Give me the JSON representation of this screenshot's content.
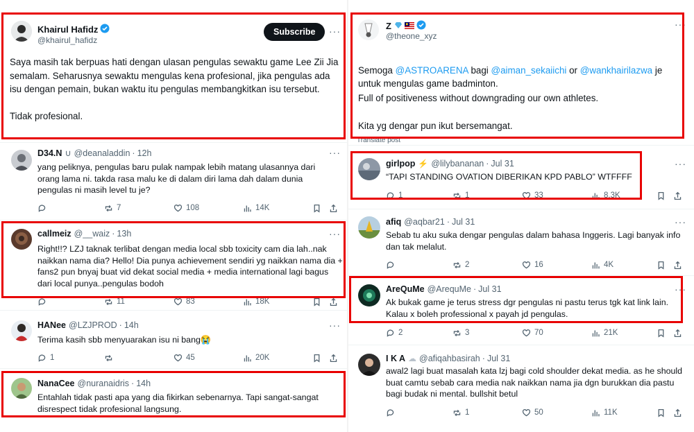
{
  "left": {
    "main": {
      "name": "Khairul Hafidz",
      "handle": "@khairul_hafidz",
      "subscribe": "Subscribe",
      "body": "Saya masih tak berpuas hati dengan ulasan pengulas sewaktu game Lee Zii Jia semalam. Seharusnya sewaktu mengulas kena profesional, jika pengulas ada isu dengan pemain, bukan waktu itu pengulas membangkitkan isu tersebut.\n\nTidak profesional."
    },
    "replies": [
      {
        "name": "D34.N",
        "badge": "∪",
        "handle": "@deanaladdin",
        "time": "12h",
        "body": "yang peliknya, pengulas baru pulak nampak lebih matang ulasannya dari orang lama ni. takda rasa malu ke di dalam diri lama dah dalam dunia pengulas ni masih level tu je?",
        "replies": "",
        "reposts": "7",
        "likes": "108",
        "views": "14K"
      },
      {
        "name": "callmeiz",
        "handle": "@__waiz",
        "time": "13h",
        "body": "Right!!? LZJ taknak terlibat dengan media local sbb toxicity cam dia lah..nak naikkan nama dia? Hello! Dia punya achievement sendiri yg naikkan nama dia + fans2 pun bnyaj buat vid dekat social media + media international lagi bagus dari local punya..pengulas bodoh",
        "replies": "",
        "reposts": "11",
        "likes": "83",
        "views": "18K"
      },
      {
        "name": "HANee",
        "handle": "@LZJPROD",
        "time": "14h",
        "body": "Terima kasih sbb menyuarakan isu ni bang😭",
        "replies": "1",
        "reposts": "",
        "likes": "45",
        "views": "20K"
      },
      {
        "name": "NanaCee",
        "handle": "@nuranaidris",
        "time": "14h",
        "body": "Entahlah tidak pasti apa yang dia fikirkan sebenarnya. Tapi sangat-sangat disrespect tidak profesional langsung."
      }
    ]
  },
  "right": {
    "main": {
      "name": "Z",
      "handle": "@theone_xyz",
      "body_pre": "Semoga ",
      "mention1": "@ASTROARENA",
      "body_mid1": " bagi ",
      "mention2": "@aiman_sekaiichi",
      "body_mid2": " or ",
      "mention3": "@wankhairilazwa",
      "body_post": " je untuk mengulas game badminton.",
      "para2": "Full of positiveness without downgrading our own athletes.",
      "para3": "Kita yg dengar pun ikut bersemangat.",
      "translate": "Translate post"
    },
    "replies": [
      {
        "name": "girlpop",
        "handle": "@lilybananan",
        "time": "Jul 31",
        "body": "“TAPI STANDING OVATION DIBERIKAN KPD PABLO” WTFFFF",
        "replies": "1",
        "reposts": "1",
        "likes": "33",
        "views": "8.3K"
      },
      {
        "name": "afiq",
        "handle": "@aqbar21",
        "time": "Jul 31",
        "body": "Sebab tu aku suka dengar pengulas dalam bahasa Inggeris. Lagi banyak info dan tak melalut.",
        "replies": "",
        "reposts": "2",
        "likes": "16",
        "views": "4K"
      },
      {
        "name": "AreQuMe",
        "handle": "@ArequMe",
        "time": "Jul 31",
        "body": "Ak bukak game je terus stress dgr pengulas ni pastu terus tgk kat link lain. Kalau x boleh professional x payah jd pengulas.",
        "replies": "2",
        "reposts": "3",
        "likes": "70",
        "views": "21K"
      },
      {
        "name": "I K A",
        "handle": "@afiqahbasirah",
        "time": "Jul 31",
        "body": "awal2 lagi buat masalah kata lzj bagi cold shoulder dekat media. as he should buat camtu sebab cara media nak naikkan nama jia dgn burukkan dia pastu bagi budak ni mental. bullshit betul",
        "replies": "",
        "reposts": "1",
        "likes": "50",
        "views": "11K"
      }
    ]
  },
  "colors": {
    "highlight": "#e80000",
    "link": "#1d9bf0",
    "verified": "#1d9bf0",
    "muted": "#536471"
  }
}
